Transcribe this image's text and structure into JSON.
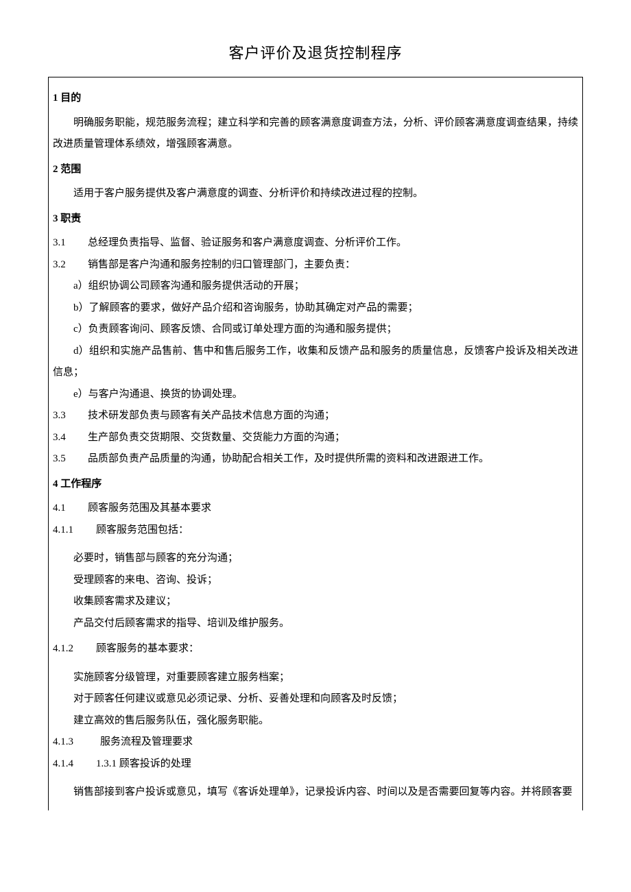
{
  "title": "客户评价及退货控制程序",
  "s1": {
    "heading": "1 目的",
    "body": "明确服务职能，规范服务流程；建立科学和完善的顾客满意度调查方法，分析、评价顾客满意度调查结果，持续改进质量管理体系绩效，增强顾客满意。"
  },
  "s2": {
    "heading": "2 范围",
    "body": "适用于客户服务提供及客户满意度的调查、分析评价和持续改进过程的控制。"
  },
  "s3": {
    "heading": "3 职责",
    "items": [
      {
        "num": "3.1",
        "text": "总经理负责指导、监督、验证服务和客户满意度调查、分析评价工作。"
      },
      {
        "num": "3.2",
        "text": "销售部是客户沟通和服务控制的归口管理部门，主要负责："
      }
    ],
    "sub32": [
      "a）组织协调公司顾客沟通和服务提供活动的开展；",
      "b）了解顾客的要求，做好产品介绍和咨询服务，协助其确定对产品的需要；",
      "c）负责顾客询问、顾客反馈、合同或订单处理方面的沟通和服务提供；",
      "d）组织和实施产品售前、售中和售后服务工作，收集和反馈产品和服务的质量信息，反馈客户投诉及相关改进信息；",
      "e）与客户沟通退、换货的协调处理。"
    ],
    "item33": {
      "num": "3.3",
      "text": "技术研发部负责与顾客有关产品技术信息方面的沟通；"
    },
    "item34": {
      "num": "3.4",
      "text": "生产部负责交货期限、交货数量、交货能力方面的沟通；"
    },
    "item35": {
      "num": "3.5",
      "text": "品质部负责产品质量的沟通，协助配合相关工作，及时提供所需的资料和改进跟进工作。"
    }
  },
  "s4": {
    "heading": "4 工作程序",
    "item41": {
      "num": "4.1",
      "text": "顾客服务范围及其基本要求"
    },
    "item411": {
      "num": "4.1.1",
      "text": "顾客服务范围包括："
    },
    "list411": [
      "必要时，销售部与顾客的充分沟通；",
      "受理顾客的来电、咨询、投诉；",
      "收集顾客需求及建议；",
      "产品交付后顾客需求的指导、培训及维护服务。"
    ],
    "item412": {
      "num": "4.1.2",
      "text": "顾客服务的基本要求："
    },
    "list412": [
      "实施顾客分级管理，对重要顾客建立服务档案；",
      "对于顾客任何建议或意见必须记录、分析、妥善处理和向顾客及时反馈；",
      "建立高效的售后服务队伍，强化服务职能。"
    ],
    "item413": {
      "num": "4.1.3",
      "text": "服务流程及管理要求"
    },
    "item414": {
      "num": "4.1.4",
      "text": "1.3.1 顾客投诉的处理"
    },
    "body414": "销售部接到客户投诉或意见，填写《客诉处理单》，记录投诉内容、时间以及是否需要回复等内容。并将顾客要"
  }
}
